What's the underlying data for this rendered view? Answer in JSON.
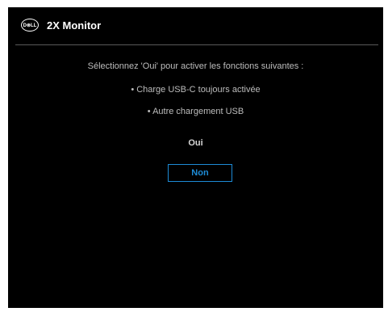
{
  "header": {
    "logo_text": "D⊗LL",
    "title": "2X Monitor"
  },
  "dialog": {
    "prompt": "Sélectionnez 'Oui' pour activer les fonctions suivantes :",
    "features": [
      "• Charge USB-C toujours activée",
      "• Autre chargement USB"
    ],
    "options": {
      "yes_label": "Oui",
      "no_label": "Non",
      "selected": "Non"
    }
  },
  "colors": {
    "background": "#000000",
    "accent": "#1d8bd6",
    "text": "#bdbdbd",
    "title": "#ffffff"
  }
}
